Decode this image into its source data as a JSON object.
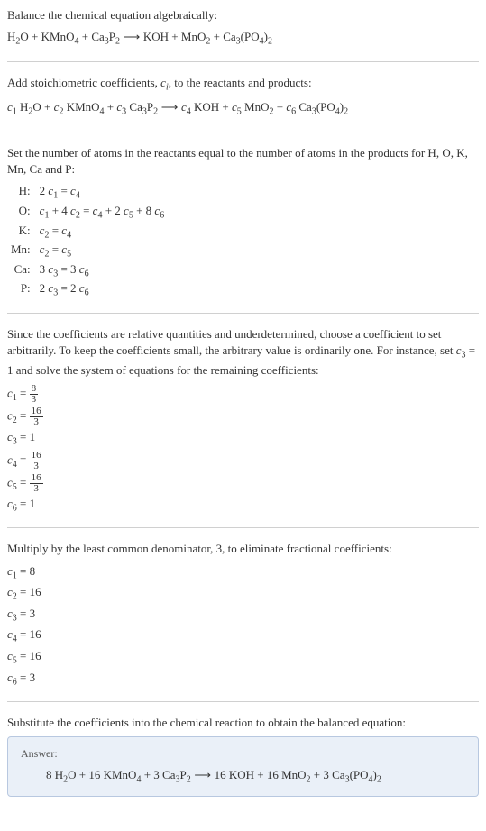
{
  "section1": {
    "title": "Balance the chemical equation algebraically:",
    "equation_parts": {
      "h2o": "H",
      "h2o_sub": "2",
      "o": "O",
      "plus1": " + ",
      "kmno4": "KMnO",
      "kmno4_sub": "4",
      "plus2": " + ",
      "ca3p2": "Ca",
      "ca3p2_sub1": "3",
      "p": "P",
      "ca3p2_sub2": "2",
      "arrow": " ⟶ ",
      "koh": "KOH",
      "plus3": " + ",
      "mno2": "MnO",
      "mno2_sub": "2",
      "plus4": " + ",
      "ca3po42_ca": "Ca",
      "ca3po42_sub1": "3",
      "po4_open": "(PO",
      "po4_sub": "4",
      "po4_close": ")",
      "ca3po42_sub2": "2"
    }
  },
  "section2": {
    "title_pre": "Add stoichiometric coefficients, ",
    "ci": "c",
    "ci_sub": "i",
    "title_post": ", to the reactants and products:",
    "eq": {
      "c1": "c",
      "c1_sub": "1",
      "sp1": " H",
      "h2o_sub": "2",
      "o": "O + ",
      "c2": "c",
      "c2_sub": "2",
      "sp2": " KMnO",
      "kmno4_sub": "4",
      "plus2": " + ",
      "c3": "c",
      "c3_sub": "3",
      "sp3": " Ca",
      "ca3_sub": "3",
      "p": "P",
      "p2_sub": "2",
      "arrow": " ⟶ ",
      "c4": "c",
      "c4_sub": "4",
      "sp4": " KOH + ",
      "c5": "c",
      "c5_sub": "5",
      "sp5": " MnO",
      "mno2_sub": "2",
      "plus5": " + ",
      "c6": "c",
      "c6_sub": "6",
      "sp6": " Ca",
      "ca3_sub2": "3",
      "po4": "(PO",
      "po4_sub": "4",
      "close": ")",
      "close_sub": "2"
    }
  },
  "section3": {
    "title": "Set the number of atoms in the reactants equal to the number of atoms in the products for H, O, K, Mn, Ca and P:",
    "atoms": [
      {
        "label": "H:",
        "eq_pre": "2 ",
        "c_a": "c",
        "c_a_sub": "1",
        "mid": " = ",
        "c_b": "c",
        "c_b_sub": "4",
        "post": ""
      },
      {
        "label": "O:",
        "eq_full_html": true
      }
    ],
    "h_label": "H:",
    "o_label": "O:",
    "k_label": "K:",
    "mn_label": "Mn:",
    "ca_label": "Ca:",
    "p_label": "P:",
    "h_eq_1": "2 ",
    "h_eq_c1": "c",
    "h_eq_c1s": "1",
    "h_eq_eq": " = ",
    "h_eq_c4": "c",
    "h_eq_c4s": "4",
    "o_c1": "c",
    "o_c1s": "1",
    "o_p1": " + 4 ",
    "o_c2": "c",
    "o_c2s": "2",
    "o_eq": " = ",
    "o_c4": "c",
    "o_c4s": "4",
    "o_p2": " + 2 ",
    "o_c5": "c",
    "o_c5s": "5",
    "o_p3": " + 8 ",
    "o_c6": "c",
    "o_c6s": "6",
    "k_c2": "c",
    "k_c2s": "2",
    "k_eq": " = ",
    "k_c4": "c",
    "k_c4s": "4",
    "mn_c2": "c",
    "mn_c2s": "2",
    "mn_eq": " = ",
    "mn_c5": "c",
    "mn_c5s": "5",
    "ca_3": "3 ",
    "ca_c3": "c",
    "ca_c3s": "3",
    "ca_eq": " = 3 ",
    "ca_c6": "c",
    "ca_c6s": "6",
    "p_2": "2 ",
    "p_c3": "c",
    "p_c3s": "3",
    "p_eq": " = 2 ",
    "p_c6": "c",
    "p_c6s": "6"
  },
  "section4": {
    "text_pre": "Since the coefficients are relative quantities and underdetermined, choose a coefficient to set arbitrarily. To keep the coefficients small, the arbitrary value is ordinarily one. For instance, set ",
    "c3": "c",
    "c3_sub": "3",
    "text_mid": " = 1 and solve the system of equations for the remaining coefficients:",
    "c1_lhs": "c",
    "c1_lhs_sub": "1",
    "c1_eq": " = ",
    "c1_num": "8",
    "c1_den": "3",
    "c2_lhs": "c",
    "c2_lhs_sub": "2",
    "c2_eq": " = ",
    "c2_num": "16",
    "c2_den": "3",
    "c3_lhs": "c",
    "c3_lhs_sub": "3",
    "c3_rhs": " = 1",
    "c4_lhs": "c",
    "c4_lhs_sub": "4",
    "c4_eq": " = ",
    "c4_num": "16",
    "c4_den": "3",
    "c5_lhs": "c",
    "c5_lhs_sub": "5",
    "c5_eq": " = ",
    "c5_num": "16",
    "c5_den": "3",
    "c6_lhs": "c",
    "c6_lhs_sub": "6",
    "c6_rhs": " = 1"
  },
  "section5": {
    "title": "Multiply by the least common denominator, 3, to eliminate fractional coefficients:",
    "c1": "c",
    "c1s": "1",
    "c1v": " = 8",
    "c2": "c",
    "c2s": "2",
    "c2v": " = 16",
    "c3": "c",
    "c3s": "3",
    "c3v": " = 3",
    "c4": "c",
    "c4s": "4",
    "c4v": " = 16",
    "c5": "c",
    "c5s": "5",
    "c5v": " = 16",
    "c6": "c",
    "c6s": "6",
    "c6v": " = 3"
  },
  "section6": {
    "title": "Substitute the coefficients into the chemical reaction to obtain the balanced equation:",
    "answer_label": "Answer:",
    "eq": {
      "c1": "8 H",
      "h2o_sub": "2",
      "o_p": "O + 16 KMnO",
      "kmno4_sub": "4",
      "p2": " + 3 Ca",
      "ca3_sub": "3",
      "p_": "P",
      "p2_sub": "2",
      "arrow": " ⟶ ",
      "koh": "16 KOH + 16 MnO",
      "mno2_sub": "2",
      "p4": " + 3 Ca",
      "ca3_sub2": "3",
      "po4": "(PO",
      "po4_sub": "4",
      "close": ")",
      "close_sub": "2"
    }
  },
  "chart_data": {
    "type": "table",
    "title": "Balanced chemical equation coefficients",
    "reaction_unbalanced": "H2O + KMnO4 + Ca3P2 -> KOH + MnO2 + Ca3(PO4)2",
    "atom_balance_equations": {
      "H": "2 c1 = c4",
      "O": "c1 + 4 c2 = c4 + 2 c5 + 8 c6",
      "K": "c2 = c4",
      "Mn": "c2 = c5",
      "Ca": "3 c3 = 3 c6",
      "P": "2 c3 = 2 c6"
    },
    "fractional_coefficients_c3_eq_1": {
      "c1": "8/3",
      "c2": "16/3",
      "c3": 1,
      "c4": "16/3",
      "c5": "16/3",
      "c6": 1
    },
    "lcd": 3,
    "integer_coefficients": {
      "c1": 8,
      "c2": 16,
      "c3": 3,
      "c4": 16,
      "c5": 16,
      "c6": 3
    },
    "balanced_equation": "8 H2O + 16 KMnO4 + 3 Ca3P2 -> 16 KOH + 16 MnO2 + 3 Ca3(PO4)2"
  }
}
